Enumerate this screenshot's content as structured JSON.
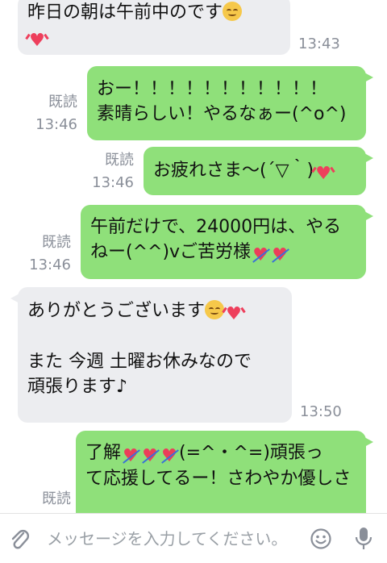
{
  "read_label": "既読",
  "messages": [
    {
      "id": "m1",
      "side": "in",
      "lines": [
        "昨日の朝は午前中のです",
        ""
      ],
      "time": "13:43"
    },
    {
      "id": "m2",
      "side": "out",
      "lines": [
        "おー！！！！！！！！！！！",
        "素晴らしい！やるなぁー(^o^)"
      ],
      "read": "既読",
      "time": "13:46"
    },
    {
      "id": "m3",
      "side": "out",
      "lines": [
        "お疲れさま〜(´▽｀)"
      ],
      "read": "既読",
      "time": "13:46"
    },
    {
      "id": "m4",
      "side": "out",
      "lines": [
        "午前だけで、24000円は、やる",
        "ねー(^^)vご苦労様"
      ],
      "read": "既読",
      "time": "13:46"
    },
    {
      "id": "m5",
      "side": "in",
      "lines": [
        "ありがとうございます",
        "",
        "また 今週 土曜お休みなので",
        "頑張ります♪"
      ],
      "time": "13:50"
    },
    {
      "id": "m6",
      "side": "out",
      "lines": [
        "了解",
        "(=^・^=)頑張っ",
        "て応援してるー！さわやか優しさ"
      ],
      "read": "既読"
    }
  ],
  "input": {
    "placeholder": "メッセージを入力してください。"
  },
  "icons": {
    "attach": "paperclip-icon",
    "emoji": "emoji-icon",
    "mic": "microphone-icon",
    "smile": "relieved-face-emoji",
    "heart": "sparkling-heart-emoji",
    "arrow_heart": "heart-with-arrow-emoji"
  },
  "colors": {
    "outgoing": "#8fe07a",
    "incoming": "#ecedf0",
    "meta": "#8a8f99"
  }
}
